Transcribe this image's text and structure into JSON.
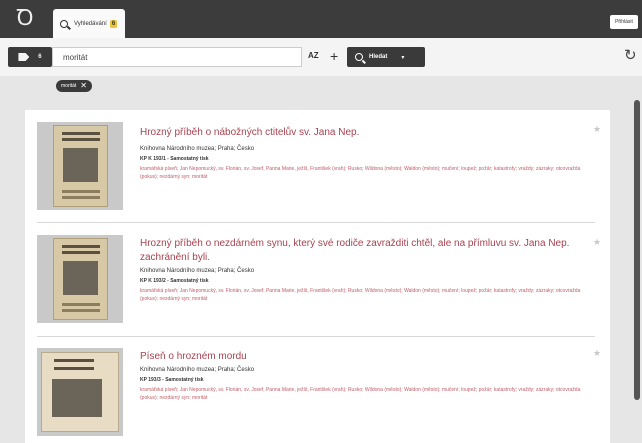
{
  "topbar": {
    "logo_glyph": "Ꝺ",
    "tab": {
      "label": "Vyhledávání",
      "count": "6"
    },
    "login_label": "Přihlásit"
  },
  "search": {
    "tag_count": "6",
    "query": "moritát",
    "sort_label": "AZ",
    "add_label": "+",
    "button_label": "Hledat",
    "button_caret": "▾",
    "reload_glyph": "↻"
  },
  "filters": [
    {
      "label": "moritát",
      "remove": "✕"
    }
  ],
  "results": [
    {
      "title": "Hrozný příběh o nábožných ctitelův sv. Jana Nep.",
      "library": "Knihovna Národního muzea; Praha; Česko",
      "shelfmark": "KP K 193/1 - Samostatný tisk",
      "tags": "kramářská píseň; Jan Nepomucký, sv. Florián, sv. Josef, Panna Marie, ježíš, František (vrah); Rusko; Wildona (město); Waldon (město); mučení; loupež; požár; katastrofy; vraždy; zázraky; otcovražda (pokus); nezdárný syn; moritát",
      "star": "★"
    },
    {
      "title": "Hrozný příběh o nezdárném synu, který své rodiče zavražditi chtěl, ale na přímluvu sv. Jana Nep. zachránění byli.",
      "library": "Knihovna Národního muzea; Praha; Česko",
      "shelfmark": "KP K 193/2 - Samostatný tisk",
      "tags": "kramářská píseň; Jan Nepomucký, sv. Florián, sv. Josef, Panna Marie, ježíš, František (vrah); Rusko; Wildona (město); Waldon (město); mučení; loupež; požár; katastrofy; vraždy; zázraky; otcovražda (pokus); nezdárný syn; moritát",
      "star": "★"
    },
    {
      "title": "Píseň o hrozném mordu",
      "library": "Knihovna Národního muzea; Praha; Česko",
      "shelfmark": "KP 193/3 - Samostatný tisk",
      "tags": "kramářská píseň; Jan Nepomucký, sv. Florián, sv. Josef, Panna Marie, ježíš, František (vrah); Rusko; Wildona (město); Waldon (město); mučení; loupež; požár; katastrofy; vraždy; zázraky; otcovražda (pokus); nezdárný syn; moritát",
      "star": "★"
    }
  ],
  "colors": {
    "topbar": "#3c3c3c",
    "accent_title": "#a7424f",
    "badge": "#e9c53a"
  }
}
